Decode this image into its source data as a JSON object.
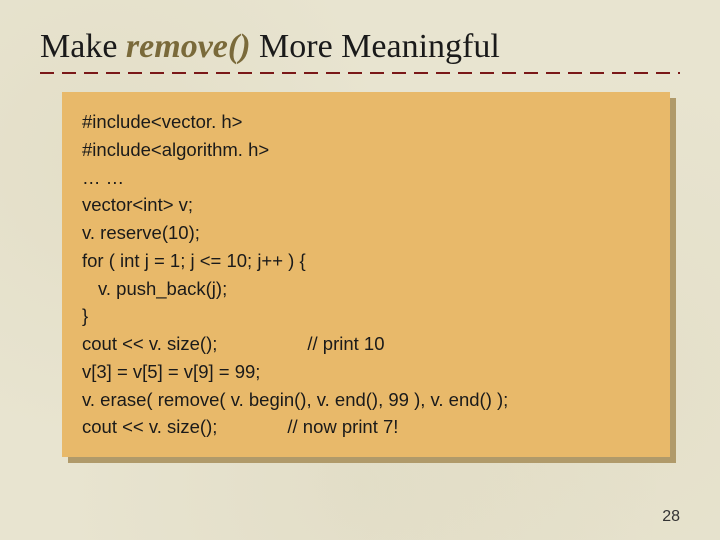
{
  "title": {
    "pre": "Make ",
    "italic": "remove()",
    "post": " More Meaningful"
  },
  "code": {
    "l0": "#include<vector. h>",
    "l1": "#include<algorithm. h>",
    "l2": "… …",
    "l3": "vector<int> v;",
    "l4": "v. reserve(10);",
    "l5": "for ( int j = 1; j <= 10; j++ ) {",
    "l6": "v. push_back(j);",
    "l7": "}",
    "l8a": "cout << v. size();",
    "l8b": "// print 10",
    "l9": "v[3] = v[5] = v[9] = 99;",
    "l10": "v. erase( remove( v. begin(), v. end(), 99 ), v. end() );",
    "l11a": "cout << v. size();",
    "l11b": "// now print 7!"
  },
  "page_number": "28"
}
